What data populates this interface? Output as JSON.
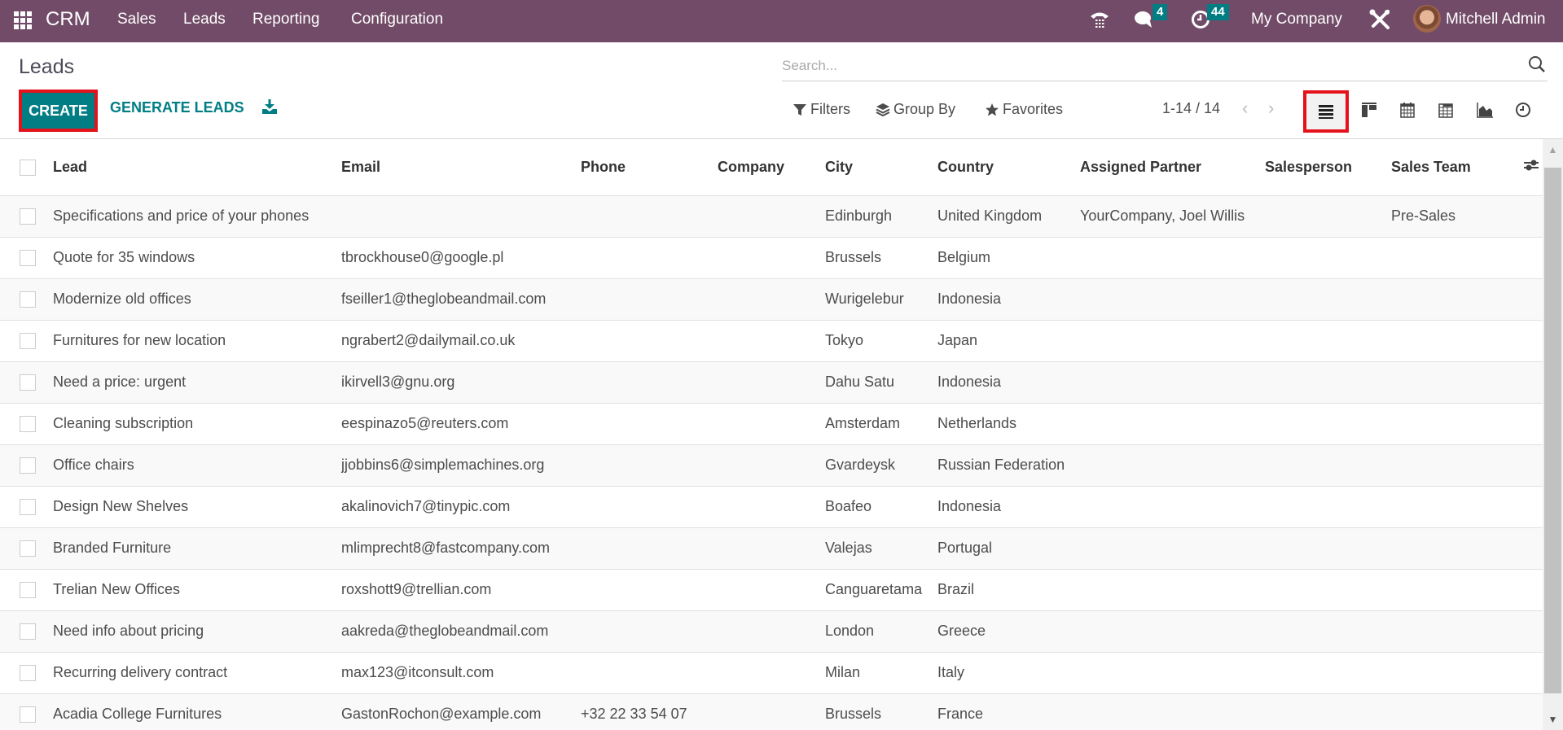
{
  "navbar": {
    "app_name": "CRM",
    "menu": [
      "Sales",
      "Leads",
      "Reporting",
      "Configuration"
    ],
    "messages_count": "4",
    "activities_count": "44",
    "company": "My Company",
    "user": "Mitchell Admin",
    "brand_color": "#714b67",
    "badge_color": "#017e84"
  },
  "control_panel": {
    "title": "Leads",
    "create_label": "CREATE",
    "generate_label": "GENERATE LEADS",
    "search_placeholder": "Search...",
    "filters_label": "Filters",
    "groupby_label": "Group By",
    "favorites_label": "Favorites",
    "pager": "1-14 / 14",
    "accent_color": "#017e84",
    "highlight_color": "#e3121b",
    "views": [
      "list",
      "kanban",
      "calendar",
      "pivot",
      "graph",
      "activity"
    ],
    "active_view": "list"
  },
  "table": {
    "columns": [
      "Lead",
      "Email",
      "Phone",
      "Company",
      "City",
      "Country",
      "Assigned Partner",
      "Salesperson",
      "Sales Team"
    ],
    "rows": [
      [
        "Specifications and price of your phones",
        "",
        "",
        "",
        "Edinburgh",
        "United Kingdom",
        "YourCompany, Joel Willis",
        "",
        "Pre-Sales"
      ],
      [
        "Quote for 35 windows",
        "tbrockhouse0@google.pl",
        "",
        "",
        "Brussels",
        "Belgium",
        "",
        "",
        ""
      ],
      [
        "Modernize old offices",
        "fseiller1@theglobeandmail.com",
        "",
        "",
        "Wurigelebur",
        "Indonesia",
        "",
        "",
        ""
      ],
      [
        "Furnitures for new location",
        "ngrabert2@dailymail.co.uk",
        "",
        "",
        "Tokyo",
        "Japan",
        "",
        "",
        ""
      ],
      [
        "Need a price: urgent",
        "ikirvell3@gnu.org",
        "",
        "",
        "Dahu Satu",
        "Indonesia",
        "",
        "",
        ""
      ],
      [
        "Cleaning subscription",
        "eespinazo5@reuters.com",
        "",
        "",
        "Amsterdam",
        "Netherlands",
        "",
        "",
        ""
      ],
      [
        "Office chairs",
        "jjobbins6@simplemachines.org",
        "",
        "",
        "Gvardeysk",
        "Russian Federation",
        "",
        "",
        ""
      ],
      [
        "Design New Shelves",
        "akalinovich7@tinypic.com",
        "",
        "",
        "Boafeo",
        "Indonesia",
        "",
        "",
        ""
      ],
      [
        "Branded Furniture",
        "mlimprecht8@fastcompany.com",
        "",
        "",
        "Valejas",
        "Portugal",
        "",
        "",
        ""
      ],
      [
        "Trelian New Offices",
        "roxshott9@trellian.com",
        "",
        "",
        "Canguaretama",
        "Brazil",
        "",
        "",
        ""
      ],
      [
        "Need info about pricing",
        "aakreda@theglobeandmail.com",
        "",
        "",
        "London",
        "Greece",
        "",
        "",
        ""
      ],
      [
        "Recurring delivery contract",
        "max123@itconsult.com",
        "",
        "",
        "Milan",
        "Italy",
        "",
        "",
        ""
      ],
      [
        "Acadia College Furnitures",
        "GastonRochon@example.com",
        "+32 22 33 54 07",
        "",
        "Brussels",
        "France",
        "",
        "",
        ""
      ]
    ]
  }
}
